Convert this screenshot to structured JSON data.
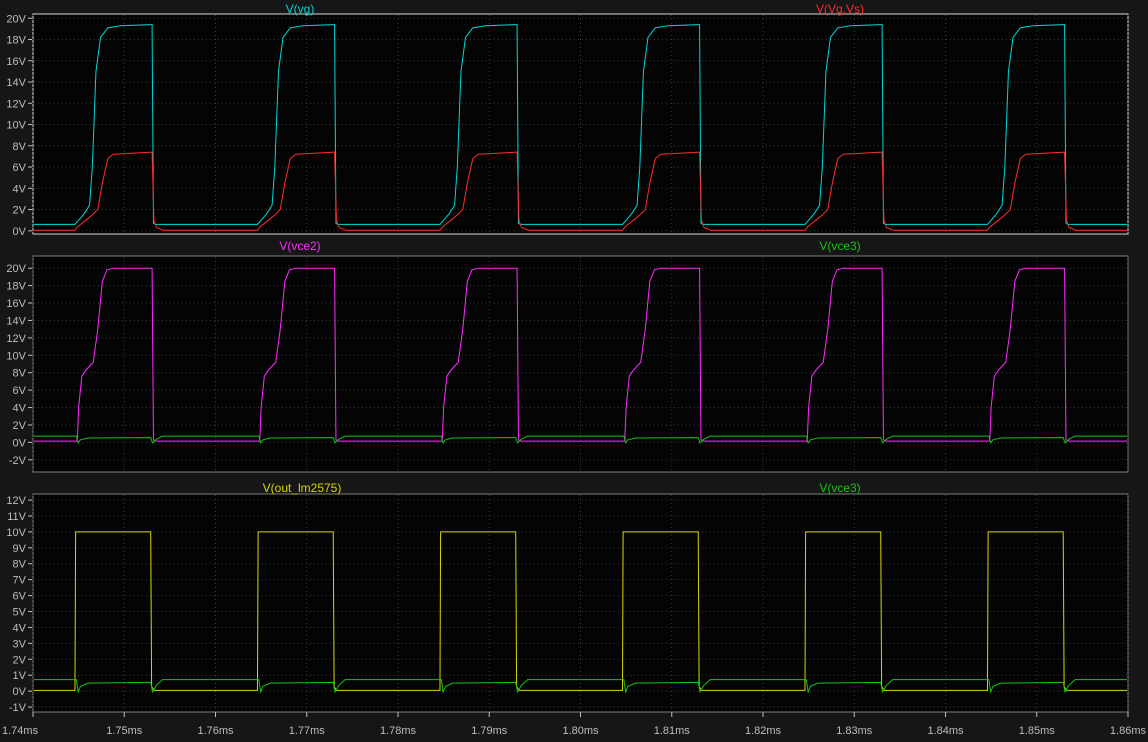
{
  "window": {
    "kind": "spice-waveform-viewer"
  },
  "colors": {
    "background": "#161616",
    "plot_background": "#040404",
    "grid": "#3d3d3d",
    "pane_border": "#7f7f7f",
    "active_pane_border": "#d9d9d9",
    "axis_text": "#bdbdbd"
  },
  "time_axis": {
    "start_ms": 1.74,
    "end_ms": 1.86,
    "tick_step_ms": 0.01,
    "tick_labels": [
      "1.74ms",
      "1.75ms",
      "1.76ms",
      "1.77ms",
      "1.78ms",
      "1.79ms",
      "1.80ms",
      "1.81ms",
      "1.82ms",
      "1.83ms",
      "1.84ms",
      "1.85ms",
      "1.86ms"
    ]
  },
  "chart_data": [
    {
      "type": "line",
      "pane": "top",
      "titles": [
        {
          "label": "V(vg)",
          "color": "#00d8d8"
        },
        {
          "label": "V(Vg,Vs)",
          "color": "#ff2b2b"
        }
      ],
      "ylim": [
        0,
        20
      ],
      "grid": true,
      "ytick_values": [
        0,
        2,
        4,
        6,
        8,
        10,
        12,
        14,
        16,
        18,
        20
      ],
      "ytick_labels": [
        "0V",
        "2V",
        "4V",
        "6V",
        "8V",
        "10V",
        "12V",
        "14V",
        "16V",
        "18V",
        "20V"
      ],
      "series": [
        {
          "name": "V(vg)",
          "color": "#00d8d8",
          "t0_ms": 1.7446,
          "period_ms": 0.02,
          "points_us_v": [
            [
              0,
              0.6
            ],
            [
              0.2,
              0.8
            ],
            [
              1.0,
              1.6
            ],
            [
              1.6,
              2.4
            ],
            [
              1.9,
              6.0
            ],
            [
              2.3,
              15.0
            ],
            [
              2.8,
              18.2
            ],
            [
              3.6,
              19.1
            ],
            [
              5.0,
              19.3
            ],
            [
              8.3,
              19.4
            ],
            [
              8.45,
              19.4
            ],
            [
              8.6,
              0.7
            ],
            [
              8.8,
              0.6
            ],
            [
              20,
              0.6
            ]
          ]
        },
        {
          "name": "V(Vg,Vs)",
          "color": "#ff2b2b",
          "t0_ms": 1.7446,
          "period_ms": 0.02,
          "points_us_v": [
            [
              0,
              0.05
            ],
            [
              0.3,
              0.4
            ],
            [
              1.2,
              1.0
            ],
            [
              1.9,
              1.5
            ],
            [
              2.5,
              2.0
            ],
            [
              3.0,
              4.5
            ],
            [
              3.6,
              6.8
            ],
            [
              4.2,
              7.2
            ],
            [
              8.45,
              7.4
            ],
            [
              8.65,
              1.0
            ],
            [
              8.95,
              0.3
            ],
            [
              9.7,
              0.05
            ],
            [
              20,
              0.05
            ]
          ]
        }
      ]
    },
    {
      "type": "line",
      "pane": "middle",
      "titles": [
        {
          "label": "V(vce2)",
          "color": "#ff2bff"
        },
        {
          "label": "V(vce3)",
          "color": "#14c414"
        }
      ],
      "ylim": [
        -2,
        20
      ],
      "grid": true,
      "ytick_values": [
        -2,
        0,
        2,
        4,
        6,
        8,
        10,
        12,
        14,
        16,
        18,
        20
      ],
      "ytick_labels": [
        "-2V",
        "0V",
        "2V",
        "4V",
        "6V",
        "8V",
        "10V",
        "12V",
        "14V",
        "16V",
        "18V",
        "20V"
      ],
      "series": [
        {
          "name": "V(vce2)",
          "color": "#ff2bff",
          "t0_ms": 1.7446,
          "period_ms": 0.02,
          "points_us_v": [
            [
              0,
              0.15
            ],
            [
              0.25,
              0.15
            ],
            [
              0.4,
              4.0
            ],
            [
              0.75,
              7.6
            ],
            [
              1.2,
              8.3
            ],
            [
              2.0,
              9.2
            ],
            [
              2.5,
              13.0
            ],
            [
              3.0,
              18.5
            ],
            [
              3.5,
              19.8
            ],
            [
              4.2,
              20.0
            ],
            [
              8.45,
              20.0
            ],
            [
              8.6,
              0.3
            ],
            [
              8.9,
              0.15
            ],
            [
              20,
              0.15
            ]
          ]
        },
        {
          "name": "V(vce3)",
          "color": "#14c414",
          "t0_ms": 1.7446,
          "period_ms": 0.02,
          "points_us_v": [
            [
              0,
              0.72
            ],
            [
              0.15,
              0.72
            ],
            [
              0.35,
              -0.05
            ],
            [
              0.6,
              0.3
            ],
            [
              1.4,
              0.5
            ],
            [
              8.3,
              0.55
            ],
            [
              8.5,
              -0.05
            ],
            [
              8.9,
              0.35
            ],
            [
              9.6,
              0.72
            ],
            [
              20,
              0.72
            ]
          ]
        }
      ]
    },
    {
      "type": "line",
      "pane": "bottom",
      "titles": [
        {
          "label": "V(out_lm2575)",
          "color": "#d6d600"
        },
        {
          "label": "V(vce3)",
          "color": "#14c414"
        }
      ],
      "ylim": [
        -1,
        12
      ],
      "grid": true,
      "ytick_values": [
        -1,
        0,
        1,
        2,
        3,
        4,
        5,
        6,
        7,
        8,
        9,
        10,
        11,
        12
      ],
      "ytick_labels": [
        "-1V",
        "0V",
        "1V",
        "2V",
        "3V",
        "4V",
        "5V",
        "6V",
        "7V",
        "8V",
        "9V",
        "10V",
        "11V",
        "12V"
      ],
      "series": [
        {
          "name": "V(out_lm2575)",
          "color": "#d6d600",
          "t0_ms": 1.7446,
          "period_ms": 0.02,
          "points_us_v": [
            [
              0,
              0.05
            ],
            [
              0.07,
              10.0
            ],
            [
              8.3,
              10.0
            ],
            [
              8.4,
              0.3
            ],
            [
              8.65,
              0.05
            ],
            [
              20,
              0.05
            ]
          ]
        },
        {
          "name": "V(vce3)",
          "color": "#14c414",
          "t0_ms": 1.7446,
          "period_ms": 0.02,
          "points_us_v": [
            [
              0,
              0.72
            ],
            [
              0.15,
              0.72
            ],
            [
              0.35,
              -0.05
            ],
            [
              0.6,
              0.3
            ],
            [
              1.4,
              0.5
            ],
            [
              8.3,
              0.55
            ],
            [
              8.5,
              -0.05
            ],
            [
              8.9,
              0.35
            ],
            [
              9.6,
              0.72
            ],
            [
              20,
              0.72
            ]
          ]
        }
      ]
    }
  ]
}
